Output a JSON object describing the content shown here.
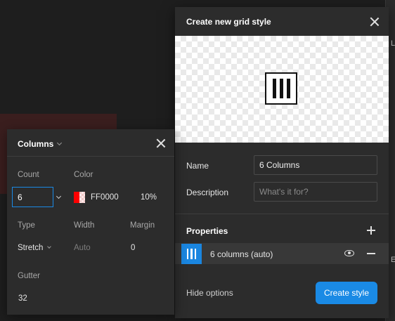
{
  "background": {
    "edge_letters": [
      "L",
      "E"
    ]
  },
  "dialog": {
    "title": "Create new grid style",
    "name_label": "Name",
    "name_value": "6 Columns",
    "description_label": "Description",
    "description_placeholder": "What's it for?",
    "properties_title": "Properties",
    "property_row": {
      "label": "6 columns (auto)",
      "swatch_color": "#1a86e0"
    },
    "hide_options": "Hide options",
    "create_button": "Create style",
    "accent_color": "#1a8ae5"
  },
  "panel": {
    "title": "Columns",
    "count_label": "Count",
    "count_value": "6",
    "color_label": "Color",
    "color_hex": "FF0000",
    "color_swatch": "#ff0000",
    "opacity": "10%",
    "type_label": "Type",
    "type_value": "Stretch",
    "width_label": "Width",
    "width_value": "Auto",
    "margin_label": "Margin",
    "margin_value": "0",
    "gutter_label": "Gutter",
    "gutter_value": "32"
  },
  "icons": {
    "close": "close-icon",
    "grid_columns": "grid-columns-icon",
    "add": "plus-icon",
    "visibility": "eye-icon",
    "remove": "minus-icon",
    "dropdown": "chevron-down-icon"
  }
}
